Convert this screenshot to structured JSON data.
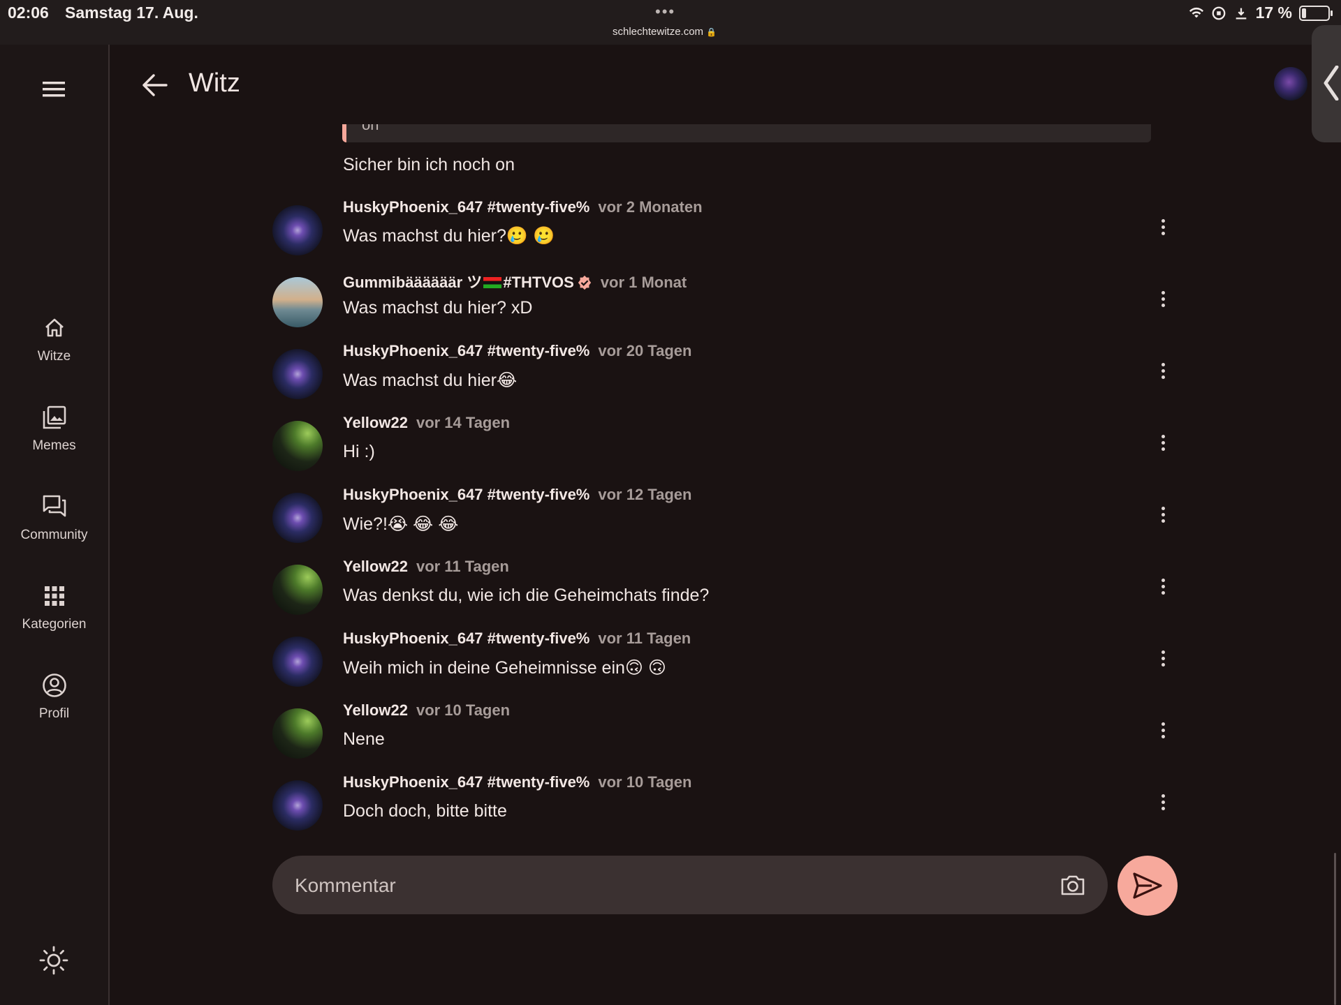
{
  "status_bar": {
    "time": "02:06",
    "date": "Samstag 17. Aug.",
    "dots": "•••",
    "url": "schlechtewitze.com",
    "battery": "17 %"
  },
  "sidebar": {
    "items": [
      {
        "label": "Witze",
        "icon": "home-icon"
      },
      {
        "label": "Memes",
        "icon": "images-icon"
      },
      {
        "label": "Community",
        "icon": "forum-icon"
      },
      {
        "label": "Kategorien",
        "icon": "grid-icon"
      },
      {
        "label": "Profil",
        "icon": "account-icon"
      }
    ]
  },
  "header": {
    "title": "Witz"
  },
  "quote": {
    "text": "on"
  },
  "prev_message": "Sicher bin ich noch on",
  "comments": [
    {
      "name": "HuskyPhoenix_647 #twenty-five%",
      "time": "vor 2 Monaten",
      "text": "Was machst du hier?🥲 🥲",
      "avatar": "phoenix"
    },
    {
      "name_pre": "Gummibäääääär ツ",
      "name_post": "#THTVOS",
      "time": "vor 1 Monat",
      "text": "Was machst du hier? xD",
      "avatar": "sunset"
    },
    {
      "name": "HuskyPhoenix_647 #twenty-five%",
      "time": "vor 20 Tagen",
      "text": "Was machst du hier😂",
      "avatar": "phoenix"
    },
    {
      "name": "Yellow22",
      "time": "vor 14 Tagen",
      "text": "Hi :)",
      "avatar": "cat"
    },
    {
      "name": "HuskyPhoenix_647 #twenty-five%",
      "time": "vor 12 Tagen",
      "text": "Wie?!😭 😂 😂",
      "avatar": "phoenix"
    },
    {
      "name": "Yellow22",
      "time": "vor 11 Tagen",
      "text": "Was denkst du, wie ich die Geheimchats finde?",
      "avatar": "cat"
    },
    {
      "name": "HuskyPhoenix_647 #twenty-five%",
      "time": "vor 11 Tagen",
      "text": "Weih mich in deine Geheimnisse ein🙃 🙃",
      "avatar": "phoenix"
    },
    {
      "name": "Yellow22",
      "time": "vor 10 Tagen",
      "text": "Nene",
      "avatar": "cat"
    },
    {
      "name": "HuskyPhoenix_647 #twenty-five%",
      "time": "vor 10 Tagen",
      "text": "Doch doch, bitte bitte",
      "avatar": "phoenix"
    }
  ],
  "composer": {
    "placeholder": "Kommentar"
  },
  "colors": {
    "background": "#1a1212",
    "accent": "#f7a99c",
    "input_bg": "#3b3131"
  }
}
